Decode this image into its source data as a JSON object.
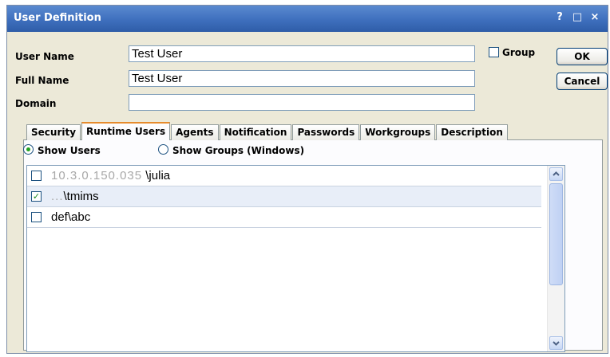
{
  "window": {
    "title": "User Definition",
    "controls": [
      "?",
      "□",
      "×"
    ]
  },
  "form": {
    "user_name_label": "User Name",
    "user_name_value": "Test User",
    "full_name_label": "Full Name",
    "full_name_value": "Test User",
    "domain_label": "Domain",
    "domain_value": "",
    "group_label": "Group",
    "group_checked": false
  },
  "buttons": {
    "ok": "OK",
    "cancel": "Cancel"
  },
  "tabs": [
    {
      "label": "Security",
      "active": false
    },
    {
      "label": "Runtime Users",
      "active": true
    },
    {
      "label": "Agents",
      "active": false
    },
    {
      "label": "Notification",
      "active": false
    },
    {
      "label": "Passwords",
      "active": false
    },
    {
      "label": "Workgroups",
      "active": false
    },
    {
      "label": "Description",
      "active": false
    }
  ],
  "radios": {
    "show_users": "Show Users",
    "show_groups": "Show Groups (Windows)",
    "selected": "show_users"
  },
  "users": [
    {
      "prefix": "10.3.0.150.035",
      "name": "\\julia",
      "checked": false
    },
    {
      "prefix": "...",
      "name": "\\tmims",
      "checked": true
    },
    {
      "prefix": "",
      "name": "def\\abc",
      "checked": false
    }
  ],
  "colors": {
    "titlebar": "#3e6fbd",
    "dialog_bg": "#ece9d8",
    "active_tab_accent": "#e68b2c",
    "radio_dot": "#21a121"
  }
}
